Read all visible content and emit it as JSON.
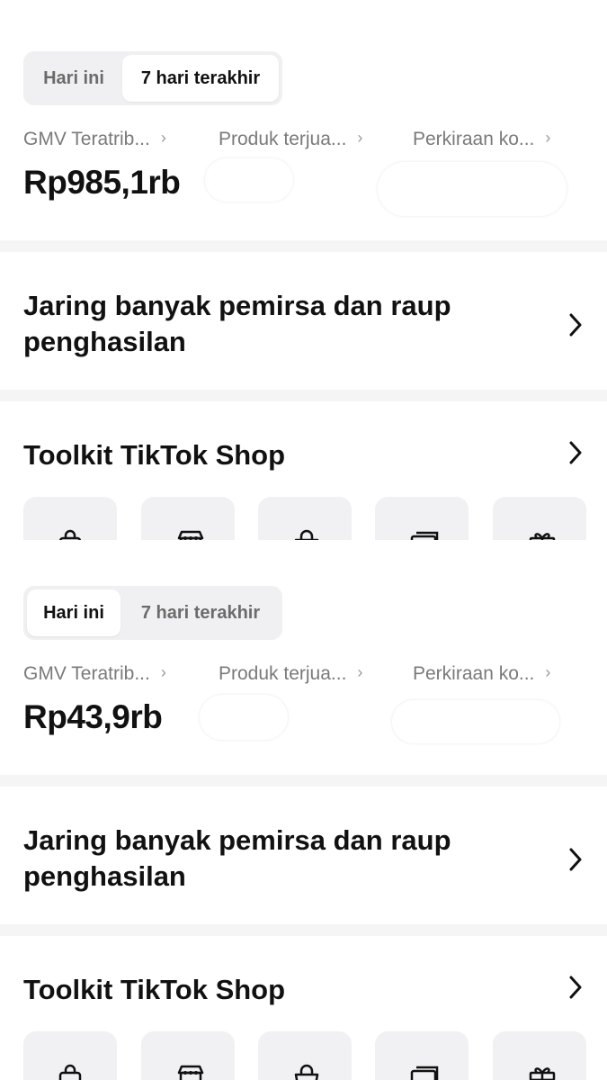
{
  "panels": [
    {
      "tabs": [
        "Hari ini",
        "7 hari terakhir"
      ],
      "active_tab": "7 hari terakhir",
      "metrics": [
        "GMV Teratrib...",
        "Produk terjua...",
        "Perkiraan ko..."
      ],
      "gmv_value": "Rp985,1rb",
      "banner_title": "Jaring banyak pemirsa dan raup penghasilan",
      "toolkit_title": "Toolkit TikTok Shop"
    },
    {
      "tabs": [
        "Hari ini",
        "7 hari terakhir"
      ],
      "active_tab": "Hari ini",
      "metrics": [
        "GMV Teratrib...",
        "Produk terjua...",
        "Perkiraan ko..."
      ],
      "gmv_value": "Rp43,9rb",
      "banner_title": "Jaring banyak pemirsa dan raup penghasilan",
      "toolkit_title": "Toolkit TikTok Shop"
    }
  ],
  "chevron_glyph": "›",
  "toolkit_icons": [
    "shopping-bag-icon",
    "storefront-icon",
    "basket-icon",
    "cards-icon",
    "gift-icon"
  ]
}
